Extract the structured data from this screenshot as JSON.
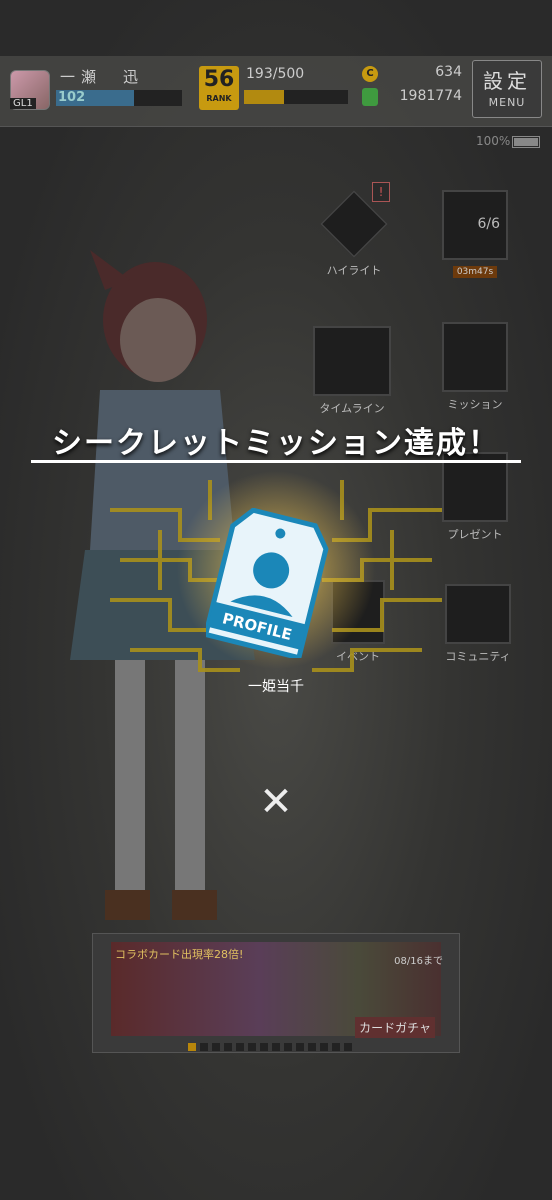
{
  "player": {
    "name": "一瀬　迅",
    "level": "102",
    "level_badge": "GL1",
    "exp_fill": 0.62
  },
  "rank": {
    "value": "56",
    "label": "RANK"
  },
  "stamina": {
    "text": "193/500",
    "fill": 0.386
  },
  "currency": {
    "coins": "634",
    "money": "1981774",
    "coin_glyph": "C"
  },
  "menu_button": {
    "label_jp": "設定",
    "label_en": "MENU"
  },
  "device": {
    "battery": "100%"
  },
  "menu_items": [
    {
      "label": "ハイライト",
      "icon": "highlight-icon",
      "alert": "!"
    },
    {
      "label": "6/6",
      "icon": "card-stack-icon",
      "timer": "03m47s"
    },
    {
      "label": "タイムライン",
      "icon": "timeline-chat-icon"
    },
    {
      "label": "ミッション",
      "icon": "mission-clipboard-icon"
    },
    {
      "label": "プレゼント",
      "icon": "present-icon"
    },
    {
      "label": "イベント",
      "icon": "event-icon"
    },
    {
      "label": "コミュニティ",
      "icon": "community-icon"
    }
  ],
  "banner": {
    "line1": "コラボカード出現率28倍!",
    "date": "08/16まで",
    "line3": "カードガチャ",
    "dots_total": 14,
    "dots_active": 0
  },
  "overlay": {
    "title": "シークレットミッション達成！",
    "reward_tag_text": "PROFILE",
    "reward_name": "一姫当千",
    "close_glyph": "✕"
  },
  "colors": {
    "gold": "#c79a10",
    "tag_blue": "#1b87b8",
    "level_bar": "#3a6c8d"
  }
}
